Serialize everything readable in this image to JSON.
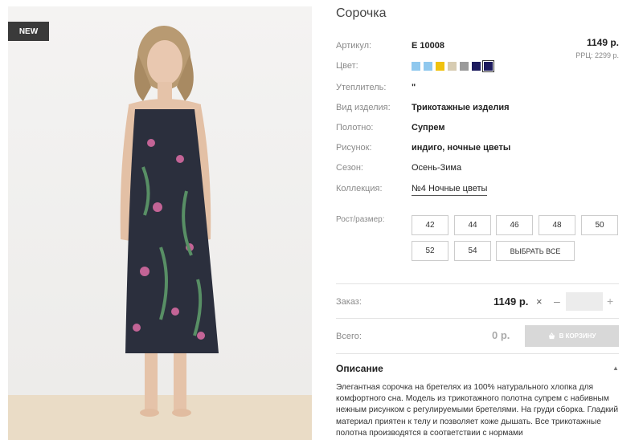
{
  "product": {
    "badge": "NEW",
    "title": "Сорочка",
    "price": "1149 р.",
    "rrp": "РРЦ: 2299 р."
  },
  "attributes": {
    "article": {
      "label": "Артикул:",
      "value": "E 10008"
    },
    "color": {
      "label": "Цвет:"
    },
    "insulation": {
      "label": "Утеплитель:",
      "value": "\""
    },
    "type": {
      "label": "Вид изделия:",
      "value": "Трикотажные изделия"
    },
    "fabric": {
      "label": "Полотно:",
      "value": "Супрем"
    },
    "pattern": {
      "label": "Рисунок:",
      "value": "индиго, ночные цветы"
    },
    "season": {
      "label": "Сезон:",
      "value": "Осень-Зима"
    },
    "collection": {
      "label": "Коллекция:",
      "value": "№4 Ночные цветы"
    }
  },
  "colors": [
    "#8fc8ee",
    "#8fc8ee",
    "#f0c20e",
    "#d7ccb2",
    "#9a9a9a",
    "#1d1b5e",
    "#1d1b5e"
  ],
  "sizes": {
    "label": "Рост/размер:",
    "options": [
      "42",
      "44",
      "46",
      "48",
      "50",
      "52",
      "54"
    ],
    "select_all": "ВЫБРАТЬ ВСЕ"
  },
  "order": {
    "label": "Заказ:",
    "price": "1149 р.",
    "times": "×",
    "minus": "–",
    "plus": "+",
    "quantity": ""
  },
  "total": {
    "label": "Всего:",
    "value": "0 р.",
    "cart_button": "В КОРЗИНУ"
  },
  "description": {
    "heading": "Описание",
    "text": "Элегантная сорочка на бретелях из 100% натурального хлопка для комфортного сна. Модель из трикотажного полотна супрем с набивным нежным рисунком с регулируемыми бретелями. На груди сборка. Гладкий материал приятен к телу и позволяет коже дышать. Все трикотажные полотна производятся в соответствии с нормами"
  }
}
